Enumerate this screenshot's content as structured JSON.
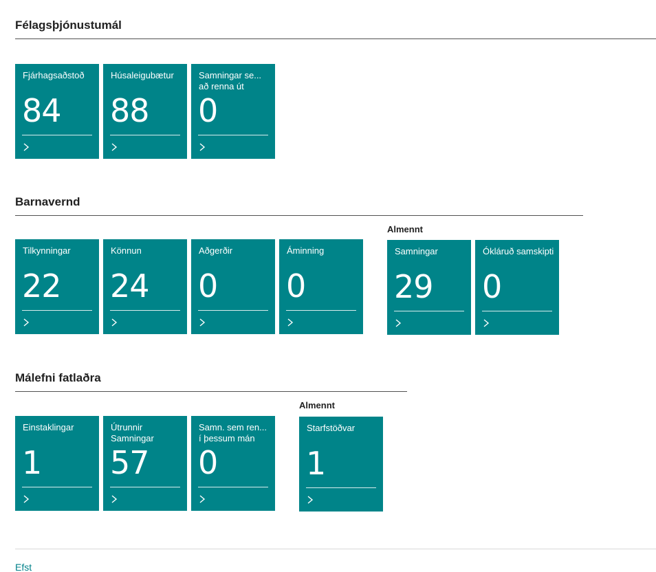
{
  "sections": [
    {
      "title": "Félagsþjónustumál",
      "tiles": [
        {
          "caption": "Fjárhagsaðstoð",
          "value": "84"
        },
        {
          "caption": "Húsaleigubætur",
          "value": "88"
        },
        {
          "caption": "Samningar se... að renna út",
          "value": "0"
        }
      ]
    },
    {
      "title": "Barnavernd",
      "tiles": [
        {
          "caption": "Tilkynningar",
          "value": "22"
        },
        {
          "caption": "Könnun",
          "value": "24"
        },
        {
          "caption": "Aðgerðir",
          "value": "0"
        },
        {
          "caption": "Áminning",
          "value": "0"
        }
      ],
      "group": {
        "label": "Almennt",
        "tiles": [
          {
            "caption": "Samningar",
            "value": "29"
          },
          {
            "caption": "Ókláruð samskipti",
            "value": "0"
          }
        ]
      }
    },
    {
      "title": "Málefni fatlaðra",
      "tiles": [
        {
          "caption": "Einstaklingar",
          "value": "1"
        },
        {
          "caption": "Útrunnir Samningar",
          "value": "57"
        },
        {
          "caption": "Samn. sem ren... í þessum mán",
          "value": "0"
        }
      ],
      "group": {
        "label": "Almennt",
        "tiles": [
          {
            "caption": "Starfstöðvar",
            "value": "1"
          }
        ]
      }
    }
  ],
  "footer": {
    "link_label": "Efst"
  },
  "colors": {
    "tile_background": "#008489",
    "link": "#00818a",
    "text": "#212121"
  },
  "icons": {
    "tile_chevron": "chevron-right-icon"
  }
}
